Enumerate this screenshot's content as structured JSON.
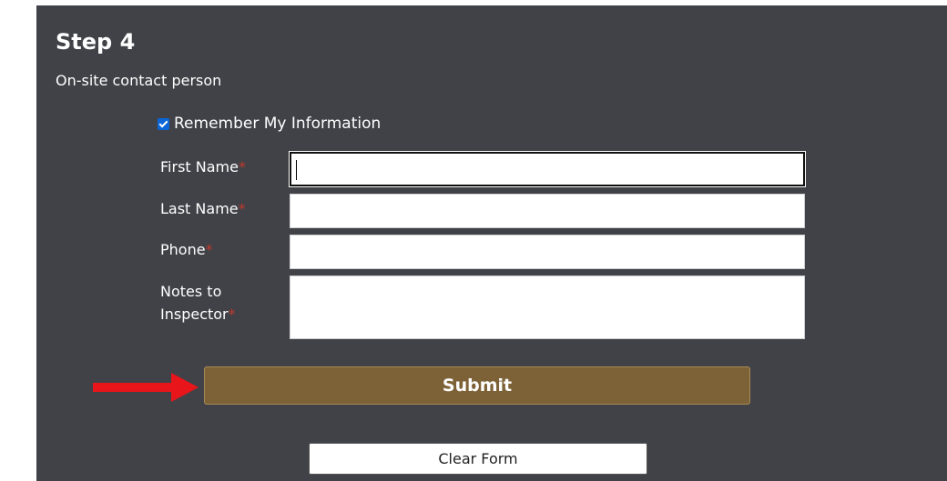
{
  "step": {
    "title": "Step 4",
    "subtitle": "On-site contact person"
  },
  "remember": {
    "label": "Remember My Information",
    "checked": true
  },
  "fields": [
    {
      "label": "First Name",
      "required_mark": "*",
      "value": ""
    },
    {
      "label": "Last Name",
      "required_mark": "*",
      "value": ""
    },
    {
      "label": "Phone",
      "required_mark": "*",
      "value": ""
    },
    {
      "label_line1": "Notes to",
      "label_line2": "Inspector",
      "required_mark": "*",
      "value": ""
    }
  ],
  "buttons": {
    "submit_label": "Submit",
    "clear_label": "Clear Form"
  },
  "colors": {
    "panel_bg": "#404248",
    "submit_bg": "#7d6237",
    "arrow": "#e8151b",
    "required": "#c0392b",
    "checkbox": "#0a66d6"
  },
  "icons": {
    "arrow": "red-arrow-right-icon",
    "checkbox": "checkbox-checked-icon"
  }
}
